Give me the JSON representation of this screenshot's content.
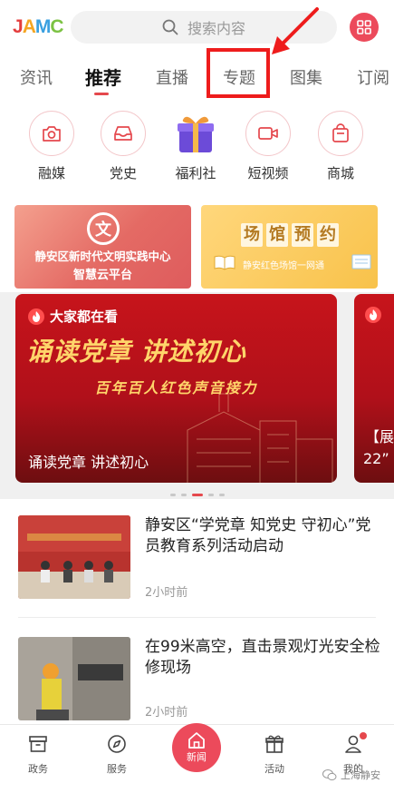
{
  "header": {
    "logo_letters": [
      "J",
      "A",
      "M",
      "C"
    ],
    "logo_colors": [
      "#e43d3d",
      "#f5a623",
      "#3aa0e0",
      "#7cc243"
    ],
    "search_placeholder": "搜索内容",
    "menu_icon": "grid-icon"
  },
  "tabs": [
    {
      "label": "资讯"
    },
    {
      "label": "推荐"
    },
    {
      "label": "直播"
    },
    {
      "label": "专题"
    },
    {
      "label": "图集"
    },
    {
      "label": "订阅"
    }
  ],
  "active_tab": "推荐",
  "accent_color": "#e5484d",
  "shortcuts": [
    {
      "label": "融媒",
      "icon": "camera-icon"
    },
    {
      "label": "党史",
      "icon": "inbox-icon"
    },
    {
      "label": "福利社",
      "icon": "gift-icon"
    },
    {
      "label": "短视频",
      "icon": "video-icon"
    },
    {
      "label": "商城",
      "icon": "shopping-bag-icon"
    }
  ],
  "banners": {
    "left": {
      "line1": "静安区新时代文明实践中心",
      "line2": "智慧云平台"
    },
    "right": {
      "title_chars": [
        "场",
        "馆",
        "预",
        "约"
      ],
      "subtitle": "静安红色场馆一网通"
    }
  },
  "carousel": {
    "tag": "大家都在看",
    "headline": "诵读党章  讲述初心",
    "subheadline": "百年百人红色声音接力",
    "caption": "诵读党章 讲述初心",
    "next_caption_line1": "【展",
    "next_caption_line2": "22”",
    "page_count": 5,
    "active_page": 3
  },
  "news": [
    {
      "title": "静安区“学党章 知党史 守初心”党员教育系列活动启动",
      "time": "2小时前"
    },
    {
      "title": "在99米高空，直击景观灯光安全检修现场",
      "time": "2小时前"
    }
  ],
  "bottom_nav": [
    {
      "label": "政务",
      "icon": "archive-box-icon"
    },
    {
      "label": "服务",
      "icon": "compass-icon"
    },
    {
      "label": "新闻",
      "icon": "home-icon"
    },
    {
      "label": "活动",
      "icon": "gift-icon"
    },
    {
      "label": "我的",
      "icon": "user-icon"
    }
  ],
  "watermark": "上海静安"
}
